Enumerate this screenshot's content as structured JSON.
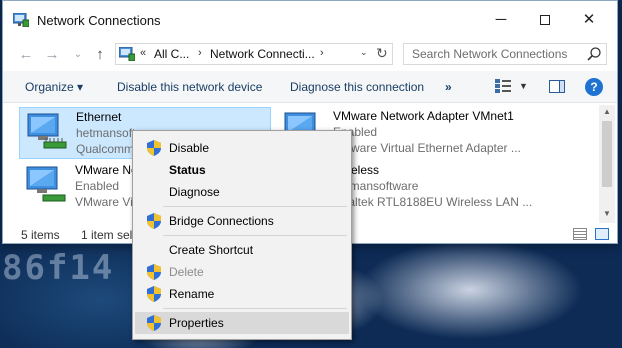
{
  "window": {
    "title": "Network Connections",
    "controls": {
      "minimize": "─",
      "close": "✕"
    }
  },
  "address": {
    "back": "←",
    "forward": "→",
    "dropdown": "⌄",
    "up": "↑",
    "crumb_sep1": "«",
    "crumb1": "All C...",
    "crumb_sep2": "›",
    "crumb2": "Network Connecti...",
    "crumb_sep3": "›",
    "dropdown_arrow": "⌄",
    "refresh": "↻"
  },
  "search": {
    "placeholder": "Search Network Connections"
  },
  "toolbar": {
    "organize": "Organize ▾",
    "disable": "Disable this network device",
    "diagnose": "Diagnose this connection",
    "more": "»",
    "view_dropdown": "▼",
    "help": "?"
  },
  "items": [
    {
      "name": "Ethernet",
      "line2": "hetmansoftware",
      "line3": "Qualcomm Atheros AR8151 PCI-E Gigabit Ethernet"
    },
    {
      "name": "VMware Network Adapter VMnet1",
      "line2": "Enabled",
      "line3": "VMware Virtual Ethernet Adapter ..."
    },
    {
      "name": "VMware Network Adapter VMnet8",
      "line2": "Enabled",
      "line3": "VMware Virtual Ethernet Adapter ..."
    },
    {
      "name": "Wireless",
      "line2": "hetmansoftware",
      "line3": "Realtek RTL8188EU Wireless LAN ..."
    }
  ],
  "status": {
    "count": "5 items",
    "selected": "1 item selected"
  },
  "scrollbar": {
    "up": "▲",
    "down": "▼"
  },
  "context_menu": {
    "items": [
      {
        "label": "Disable",
        "shield": true
      },
      {
        "label": "Status",
        "bold": true
      },
      {
        "label": "Diagnose"
      },
      {
        "label": "Bridge Connections",
        "shield": true
      },
      {
        "label": "Create Shortcut"
      },
      {
        "label": "Delete",
        "shield": true,
        "disabled": true
      },
      {
        "label": "Rename",
        "shield": true
      },
      {
        "label": "Properties",
        "shield": true,
        "highlighted": true
      }
    ]
  },
  "desktop": {
    "digits": "86f14"
  },
  "colors": {
    "selection": "#cce8ff",
    "link": "#1a3e66",
    "help": "#1e73d2",
    "shield_blue": "#2f6fd6",
    "shield_gold": "#f2c12e"
  }
}
